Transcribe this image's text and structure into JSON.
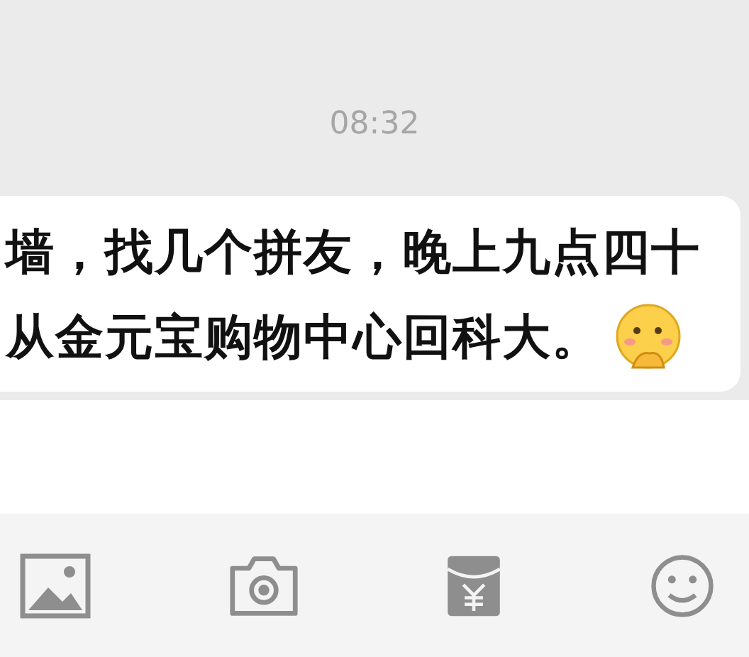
{
  "time": "08:32",
  "message": {
    "lines": [
      "墙，找几个拼友，晚上九点四十",
      "从金元宝购物中心回科大。"
    ]
  },
  "toolbar": [
    {
      "kind": "image"
    },
    {
      "kind": "camera"
    },
    {
      "kind": "red-packet"
    },
    {
      "kind": "emoji"
    }
  ]
}
